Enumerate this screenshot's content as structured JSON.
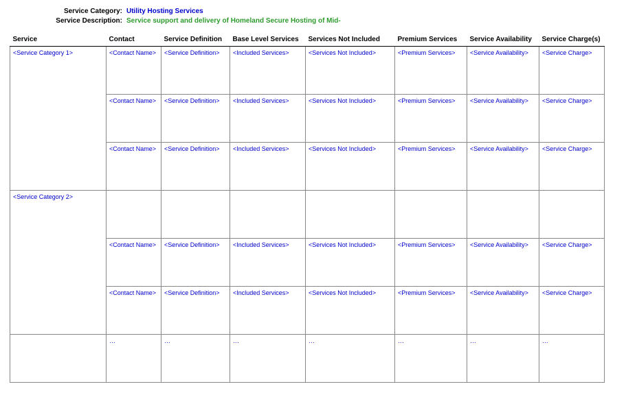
{
  "meta": {
    "category_label": "Service Category:",
    "category_value": "Utility Hosting Services",
    "description_label": "Service Description:",
    "description_value": "Service support and delivery of Homeland Secure Hosting of Mid-"
  },
  "columns": {
    "service": "Service",
    "contact": "Contact",
    "definition": "Service Definition",
    "base": "Base Level Services",
    "notincluded": "Services Not Included",
    "premium": "Premium Services",
    "availability": "Service Availability",
    "charges": "Service Charge(s)"
  },
  "categories": {
    "cat1": "<Service Category 1>",
    "cat2": "<Service Category 2>"
  },
  "placeholders": {
    "contact": "<Contact Name>",
    "definition": "<Service Definition>",
    "included": "<Included Services>",
    "notincluded": "<Services Not Included>",
    "premium": "<Premium Services>",
    "availability": "<Service Availability>",
    "charge": "<Service Charge>",
    "ellipsis": "…"
  }
}
